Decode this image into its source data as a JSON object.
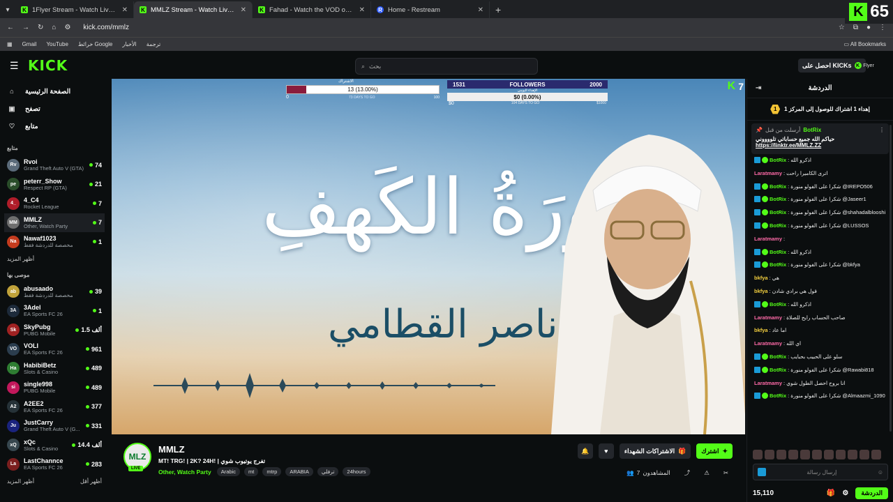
{
  "browser": {
    "tabs": [
      {
        "title": "1Flyer Stream - Watch Live on Kick",
        "icon": "kick-favicon",
        "active": false
      },
      {
        "title": "MMLZ Stream - Watch Live on Kick",
        "icon": "kick-favicon",
        "active": true
      },
      {
        "title": "Fahad - Watch the VOD on Kick",
        "icon": "kick-favicon",
        "active": false
      },
      {
        "title": "Home - Restream",
        "icon": "restream-favicon",
        "active": false
      }
    ],
    "url": "kick.com/mmlz",
    "bookmarks": [
      "Gmail",
      "YouTube",
      "خرائط Google",
      "الأخبار",
      "ترجمة"
    ],
    "all_bookmarks": "All Bookmarks",
    "extension_badge": "65"
  },
  "kick": {
    "logo": "KICK",
    "search_placeholder": "بحث",
    "get_kicks": "احصل على KICKs",
    "user_avatar_text": "Flyer"
  },
  "sidebar": {
    "nav": [
      {
        "label": "الصفحة الرئيسية",
        "icon": "home-icon"
      },
      {
        "label": "تصفح",
        "icon": "browse-icon"
      },
      {
        "label": "متابع",
        "icon": "heart-icon"
      }
    ],
    "following_title": "متابع",
    "following": [
      {
        "name": "Rvoi",
        "game": "Grand Theft Auto V (GTA)",
        "viewers": "74",
        "color": "#5b6b7a"
      },
      {
        "name": "peterr_Show",
        "game": "Respect RP (GTA)",
        "viewers": "21",
        "color": "#2a4d2a"
      },
      {
        "name": "4_C4",
        "game": "Rocket League",
        "viewers": "7",
        "color": "#b01d2a"
      },
      {
        "name": "MMLZ",
        "game": "Other, Watch Party",
        "viewers": "7",
        "color": "#6e6e6e"
      },
      {
        "name": "Nawaf1023",
        "game": "مخصصة للدردشة فقط",
        "viewers": "1",
        "color": "#c43b1e"
      }
    ],
    "show_more": "أظهر المزيد",
    "recommended_title": "موصى بها",
    "recommended": [
      {
        "name": "abusaado",
        "game": "مخصصة للدردشة فقط",
        "viewers": "39",
        "color": "#c0a23a"
      },
      {
        "name": "3Adel",
        "game": "EA Sports FC 26",
        "viewers": "1",
        "color": "#1d2a3a"
      },
      {
        "name": "SkyPubg",
        "game": "PUBG Mobile",
        "viewers": "1.5 ألف",
        "color": "#a02222"
      },
      {
        "name": "VOLI",
        "game": "EA Sports FC 26",
        "viewers": "961",
        "color": "#2b3d4e"
      },
      {
        "name": "HabibiBetz",
        "game": "Slots & Casino",
        "viewers": "489",
        "color": "#2e7d32"
      },
      {
        "name": "single998",
        "game": "PUBG Mobile",
        "viewers": "489",
        "color": "#c2185b"
      },
      {
        "name": "A2EE2",
        "game": "EA Sports FC 26",
        "viewers": "377",
        "color": "#263238"
      },
      {
        "name": "JustCarry",
        "game": "Grand Theft Auto V (G...",
        "viewers": "331",
        "color": "#1a237e"
      },
      {
        "name": "xQc",
        "game": "Slots & Casino",
        "viewers": "14.4 ألف",
        "color": "#37474f"
      },
      {
        "name": "LastChannce",
        "game": "EA Sports FC 26",
        "viewers": "283",
        "color": "#7b1f1f"
      }
    ],
    "show_more_2": "أظهر المزيد",
    "show_less": "أظهر أقل"
  },
  "player": {
    "title_art": "سُورَةُ الكَهفِ",
    "reciter_art": "ناصر القطامي",
    "subs_goal": {
      "label": "الاشتراك",
      "text": "13 (13.00%)",
      "progress": 0.13,
      "low": "0",
      "high": "100",
      "days": "73 DAYS TO GO"
    },
    "followers_goal": {
      "left": "1531",
      "label": "FOLLOWERS",
      "right": "2000",
      "sub_label": "الإهداء اليومي",
      "bar_text": "$0 (0.00%)",
      "low": "$0",
      "high": "$1000",
      "days": "104 DAYS TO GO"
    },
    "watermark_count": "7"
  },
  "stream_info": {
    "channel": "MMLZ",
    "avatar_text": "MLZ",
    "live_badge": "LIVE",
    "title": "MT! TRG! | 2K? 24H! | تفرج يوتيوب شوي",
    "category": "Other, Watch Party",
    "tags": [
      "Arabic",
      "mt",
      "mtrp",
      "ARABIA",
      "ترفلي",
      "24hours"
    ],
    "subscribe_label": "اشترك",
    "gifted_label": "الاشتراكات الشهداء",
    "viewers_label": "المشاهدون",
    "viewers": "7"
  },
  "chat": {
    "title": "الدردشة",
    "goal_text": "إهداء 1 اشتراك للوصول إلى المركز 1",
    "goal_rank": "1",
    "pinned": {
      "pinned_by": "أرسلت من قبل",
      "user": "BotRix",
      "message": "حياكم الله جميع حساباتي تلووووني",
      "link": "https://linktr.ee/MMLZ.ZZ"
    },
    "messages": [
      {
        "user": "BotRix",
        "color": "#53fc18",
        "text": "اذكرو الله",
        "badges": true
      },
      {
        "user": "Laratmamy",
        "color": "#ff6aa8",
        "text": "اترى الكاميرا راحت",
        "badges": false
      },
      {
        "user": "BotRix",
        "color": "#53fc18",
        "text": "شكرا على الفولو منورة @IREPO506",
        "badges": true
      },
      {
        "user": "BotRix",
        "color": "#53fc18",
        "text": "شكرا على الفولو منورة @Jaseer1",
        "badges": true
      },
      {
        "user": "BotRix",
        "color": "#53fc18",
        "text": "شكرا على الفولو منورة @shahadalblooshi",
        "badges": true
      },
      {
        "user": "BotRix",
        "color": "#53fc18",
        "text": "شكرا على الفولو منورة @LUSSOS",
        "badges": true
      },
      {
        "user": "Laratmamy",
        "color": "#ff6aa8",
        "text": "",
        "badges": false
      },
      {
        "user": "BotRix",
        "color": "#53fc18",
        "text": "اذكرو الله",
        "badges": true
      },
      {
        "user": "BotRix",
        "color": "#53fc18",
        "text": "شكرا على الفولو منورة @bkfya",
        "badges": true
      },
      {
        "user": "bkfya",
        "color": "#f4d03f",
        "text": "هي",
        "badges": false
      },
      {
        "user": "bkfya",
        "color": "#f4d03f",
        "text": "قول هي برادي شادن",
        "badges": false
      },
      {
        "user": "BotRix",
        "color": "#53fc18",
        "text": "اذكرو الله",
        "badges": true
      },
      {
        "user": "Laratmamy",
        "color": "#ff6aa8",
        "text": "صاحب الحساب رايح للصلاة",
        "badges": false
      },
      {
        "user": "bkfya",
        "color": "#f4d03f",
        "text": "اما عاد",
        "badges": false
      },
      {
        "user": "Laratmamy",
        "color": "#ff6aa8",
        "text": "اي الله",
        "badges": false
      },
      {
        "user": "BotRix",
        "color": "#53fc18",
        "text": "سلو على الحبيب بحبايب",
        "badges": true
      },
      {
        "user": "BotRix",
        "color": "#53fc18",
        "text": "شكرا على الفولو منورة @Rawabi818",
        "badges": true
      },
      {
        "user": "Laratmamy",
        "color": "#ff6aa8",
        "text": "انا بروح احصل الطول شوي",
        "badges": false
      },
      {
        "user": "BotRix",
        "color": "#53fc18",
        "text": "شكرا على الفولو منورة @Almaazmi_1090",
        "badges": true
      }
    ],
    "input_placeholder": "إرسال رسالة",
    "kicks_count": "15,110",
    "chat_button": "الدردشة"
  },
  "colors": {
    "accent": "#53fc18",
    "bg": "#0b0e0f",
    "panel": "#24272c"
  }
}
